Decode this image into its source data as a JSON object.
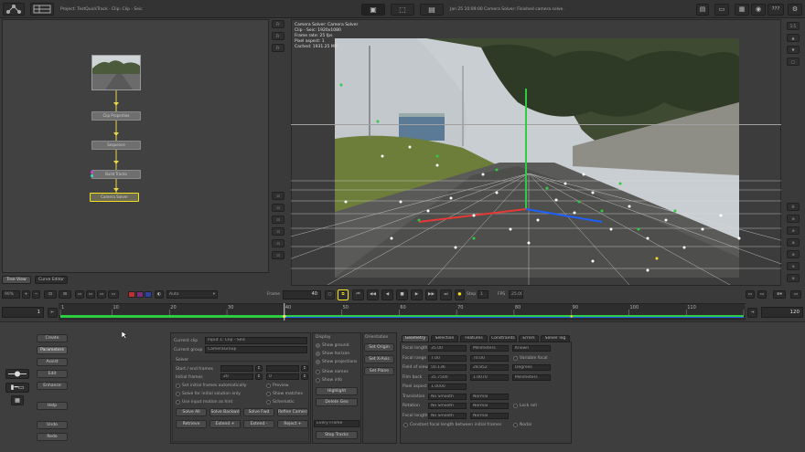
{
  "topbar": {
    "project_label": "Project: TestQuickTrack · Clip: Clip - Seic",
    "status_text": "Jan 25 10:09:00 Camera Solver: Finished camera solve.",
    "help_label": "???"
  },
  "viewer_info": {
    "line1": "Camera Solver: Camera Solver",
    "line2": "Clip - Seic: 1920x1080",
    "line3": "Frame rate: 25 fps",
    "line4": "Pixel aspect: 1",
    "line5": "Cached: 1931.25 MB"
  },
  "node_graph": {
    "nodes": [
      "",
      "Clip Properties",
      "Sequence",
      "Build Tracks",
      "Camera Solver"
    ]
  },
  "left_tabs": [
    "Tree View",
    "Curve Editor"
  ],
  "right_tools": [
    "1:1",
    "▲",
    "▼",
    "H",
    "⊕",
    "⊕",
    "⊕",
    "⊕",
    "⊕"
  ],
  "playback": {
    "zoom_value": "90%",
    "mode_select": "Auto",
    "frame_label": "Frame",
    "frame_value": "40",
    "step_label": "Step",
    "step_value": "1",
    "fps_label": "FPS",
    "fps_value": "25.00",
    "range_start": "1",
    "range_end": "120"
  },
  "timeline": {
    "ticks": [
      "1",
      "10",
      "20",
      "30",
      "40",
      "50",
      "60",
      "70",
      "80",
      "90",
      "100",
      "110",
      "12"
    ],
    "current_frame": 40,
    "first": 1,
    "last": 120
  },
  "left_toolbar": [
    "Create",
    "Parameters",
    "Assist",
    "Edit",
    "Enhance",
    "Help",
    "Undo",
    "Redo"
  ],
  "solver_panel": {
    "current_clip_label": "Current clip",
    "current_clip_value": "Input 1: Clip - Seic",
    "current_group_label": "Current group",
    "current_group_value": "CameraGroup",
    "solver_heading": "Solver",
    "start_end_frames_label": "Start / end frames",
    "initial_frames_label": "Initial frames",
    "initial_frames_values": [
      "20",
      "0"
    ],
    "options": [
      "Set initial frames automatically",
      "Solve for initial solution only",
      "Use input motion as hint"
    ],
    "options_right": [
      "Preview",
      "Show matches",
      "Schematic"
    ],
    "buttons_row1": [
      "Solve All",
      "Solve Backwd",
      "Solve Fwd",
      "Refine Camera"
    ],
    "buttons_row2": [
      "Retrieve",
      "Extend +",
      "Extend -",
      "Reject +"
    ]
  },
  "display_panel": {
    "heading": "Display",
    "options": [
      "Show ground",
      "Show horizon",
      "Show projections",
      "Show names",
      "Show info"
    ],
    "buttons": [
      "Highlight",
      "Delete Geo"
    ],
    "select_value": "Every Frame",
    "stop_button": "Stop Tracks"
  },
  "orientation_panel": {
    "heading": "Orientation",
    "buttons": [
      "Set Origin",
      "Set X-Axis",
      "Set Plane"
    ]
  },
  "camera_panel": {
    "tabs": [
      "Geometry",
      "Selection",
      "Features",
      "Constraints",
      "Errors",
      "Solver log"
    ],
    "rows": [
      {
        "label": "Focal length",
        "value": "35.00",
        "unit": "Millimeters",
        "extra": "Known"
      },
      {
        "label": "Focal range",
        "value": "7.00",
        "unit": "70.00",
        "extra": "Variable focal"
      },
      {
        "label": "Field of view",
        "value": "50.136",
        "unit": "28.852",
        "extra": "Degrees"
      },
      {
        "label": "Film back",
        "value": "35.7500",
        "unit": "1.0070",
        "extra": "Millimeters"
      },
      {
        "label": "Pixel aspect",
        "value": "1.0000",
        "unit": "",
        "extra": ""
      },
      {
        "label": "Translation",
        "value": "No Smooth",
        "unit": "Normal",
        "extra": ""
      },
      {
        "label": "Rotation",
        "value": "No Smooth",
        "unit": "Normal",
        "extra": "Lock roll"
      },
      {
        "label": "Focal length",
        "value": "No Smooth",
        "unit": "Normal",
        "extra": ""
      }
    ],
    "constant_label": "Constant focal length between initial frames",
    "nodal_label": "Nodal"
  },
  "colors": {
    "background": "#3a3a3a",
    "accent": "#f5e11c",
    "track_green": "#2ecc40",
    "axis_red": "#e53935",
    "axis_blue": "#1e60ff"
  }
}
